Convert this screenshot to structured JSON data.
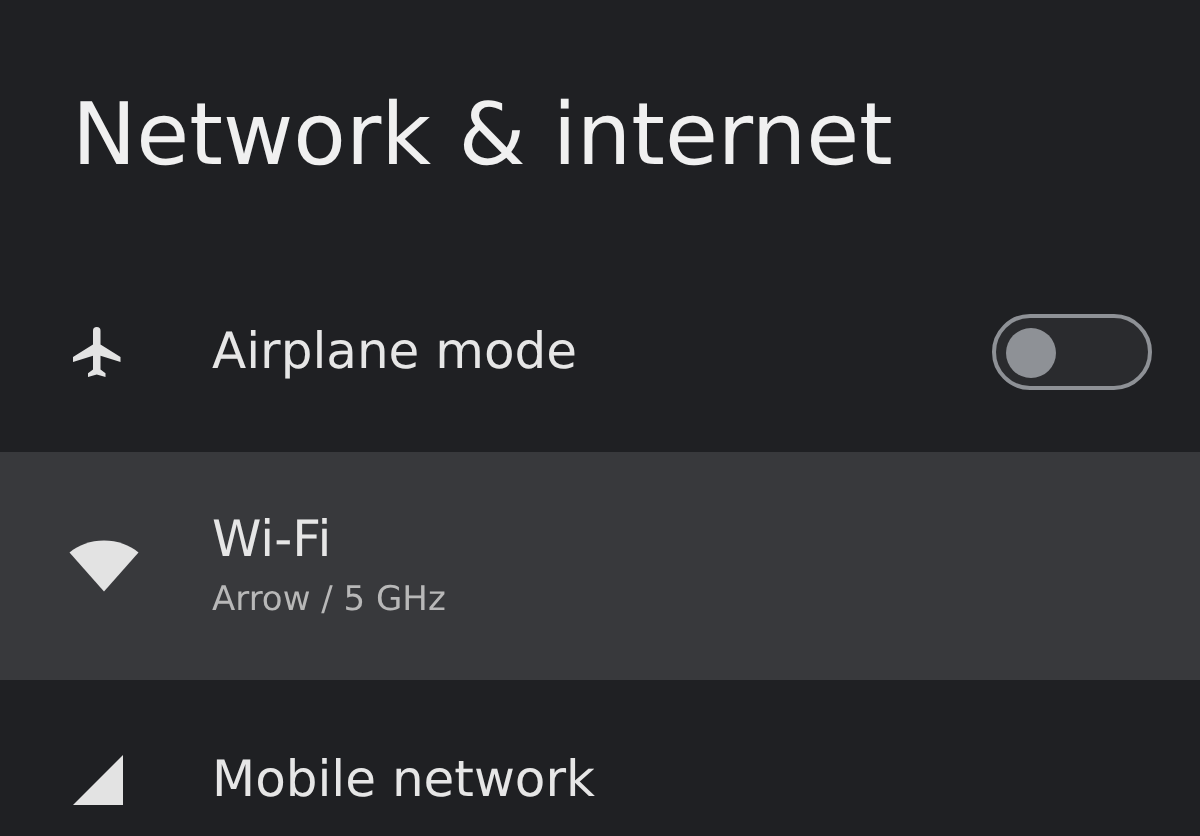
{
  "title": "Network & internet",
  "items": [
    {
      "kind": "toggle",
      "label": "Airplane mode",
      "on": false,
      "selected": false
    },
    {
      "kind": "plain",
      "label": "Wi-Fi",
      "subtitle": "Arrow / 5 GHz",
      "selected": true
    },
    {
      "kind": "plain",
      "label": "Mobile network",
      "selected": false
    }
  ]
}
